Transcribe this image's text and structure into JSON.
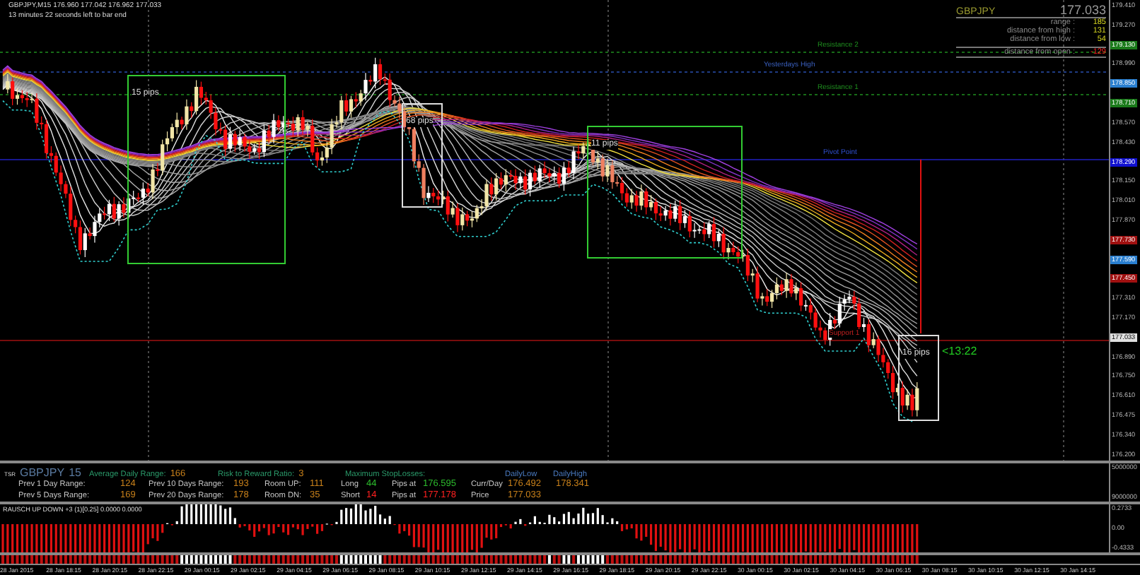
{
  "title_bar": {
    "symbol_line": "GBPJPY,M15  176.960 177.042 176.962 177.033",
    "countdown": "13 minutes 22 seconds left to bar end"
  },
  "level_lines": [
    {
      "label": "Resistance 2",
      "kind": "resistance"
    },
    {
      "label": "Yesterdays High",
      "kind": "yesterday"
    },
    {
      "label": "Resistance 1",
      "kind": "resistance"
    },
    {
      "label": "Pivot Point",
      "kind": "pivot"
    },
    {
      "label": "Support 1",
      "kind": "support"
    }
  ],
  "pip_boxes": [
    {
      "label": "15 pips",
      "color": "#33cc33"
    },
    {
      "label": "68 pips",
      "color": "#dddddd"
    },
    {
      "label": "11 pips",
      "color": "#33cc33"
    },
    {
      "label": "16 pips",
      "color": "#dddddd"
    }
  ],
  "timer": "<13:22",
  "quote_panel": {
    "symbol": "GBPJPY",
    "price": "177.033",
    "rows": [
      {
        "label": "range :",
        "value": "185",
        "kind": "up"
      },
      {
        "label": "distance from high :",
        "value": "131",
        "kind": "up"
      },
      {
        "label": "distance from low :",
        "value": "54",
        "kind": "up"
      },
      {
        "label": "distance from open :",
        "value": "-129",
        "kind": "down"
      }
    ]
  },
  "price_axis": [
    {
      "text": "179.410"
    },
    {
      "text": "179.270"
    },
    {
      "text": "179.130",
      "color": "#1a7a1a"
    },
    {
      "text": "178.990"
    },
    {
      "text": "178.850",
      "color": "#2a7fd0"
    },
    {
      "text": "178.710",
      "color": "#1a7a1a"
    },
    {
      "text": "178.570"
    },
    {
      "text": "178.430"
    },
    {
      "text": "178.290",
      "color": "#1010d0"
    },
    {
      "text": "178.150"
    },
    {
      "text": "178.010"
    },
    {
      "text": "177.870"
    },
    {
      "text": "177.730",
      "color": "#a01010"
    },
    {
      "text": "177.590",
      "color": "#2a7fd0"
    },
    {
      "text": "177.450",
      "color": "#a01010"
    },
    {
      "text": "177.310"
    },
    {
      "text": "177.170"
    },
    {
      "text": "177.033",
      "color": "#e0e0e0"
    },
    {
      "text": "176.890"
    },
    {
      "text": "176.750"
    },
    {
      "text": "176.610"
    },
    {
      "text": "176.475"
    },
    {
      "text": "176.340"
    },
    {
      "text": "176.200"
    }
  ],
  "info_panel": {
    "tag": "TSR",
    "symbol": "GBPJPY",
    "timeframe": "15",
    "headers": [
      {
        "text": "Average Daily Range:",
        "kind": "heading"
      },
      {
        "text": "166",
        "kind": "value"
      },
      {
        "text": "Risk to Reward Ratio:",
        "kind": "heading"
      },
      {
        "text": "3",
        "kind": "value"
      },
      {
        "text": "Maximum StopLosses:",
        "kind": "heading"
      },
      {
        "text": "DailyLow",
        "kind": "column"
      },
      {
        "text": "DailyHigh",
        "kind": "column"
      }
    ],
    "rows": [
      [
        {
          "text": "Prev 1 Day Range:",
          "kind": "label"
        },
        {
          "text": "124",
          "kind": "value"
        },
        {
          "text": "Prev 10 Days Range:",
          "kind": "label"
        },
        {
          "text": "193",
          "kind": "value"
        },
        {
          "text": "Room UP:",
          "kind": "label"
        },
        {
          "text": "111",
          "kind": "value"
        },
        {
          "text": "Long",
          "kind": "label"
        },
        {
          "text": "44",
          "kind": "up"
        },
        {
          "text": "Pips at",
          "kind": "label"
        },
        {
          "text": "176.595",
          "kind": "up"
        },
        {
          "text": "Curr/Day",
          "kind": "label"
        },
        {
          "text": "176.492",
          "kind": "value"
        },
        {
          "text": "178.341",
          "kind": "value"
        }
      ],
      [
        {
          "text": "Prev 5 Days Range:",
          "kind": "label"
        },
        {
          "text": "169",
          "kind": "value"
        },
        {
          "text": "Prev 20 Days Range:",
          "kind": "label"
        },
        {
          "text": "178",
          "kind": "value"
        },
        {
          "text": "Room DN:",
          "kind": "label"
        },
        {
          "text": "35",
          "kind": "value"
        },
        {
          "text": "Short",
          "kind": "label"
        },
        {
          "text": "14",
          "kind": "down"
        },
        {
          "text": "Pips at",
          "kind": "label"
        },
        {
          "text": "177.178",
          "kind": "down"
        },
        {
          "text": "Price",
          "kind": "label"
        },
        {
          "text": "177.033",
          "kind": "value"
        }
      ]
    ],
    "axis": [
      "5000000",
      "9000000"
    ]
  },
  "indicator": {
    "title": "RAUSCH UP DOWN +3 (1)[0.25] 0.0000 0.0000",
    "axis": [
      "0.2733",
      "0.00",
      "-0.4333"
    ]
  },
  "time_axis": [
    "28 Jan 2015",
    "28 Jan 18:15",
    "28 Jan 20:15",
    "28 Jan 22:15",
    "29 Jan 00:15",
    "29 Jan 02:15",
    "29 Jan 04:15",
    "29 Jan 06:15",
    "29 Jan 08:15",
    "29 Jan 10:15",
    "29 Jan 12:15",
    "29 Jan 14:15",
    "29 Jan 16:15",
    "29 Jan 18:15",
    "29 Jan 20:15",
    "29 Jan 22:15",
    "30 Jan 00:15",
    "30 Jan 02:15",
    "30 Jan 04:15",
    "30 Jan 06:15",
    "30 Jan 08:15",
    "30 Jan 10:15",
    "30 Jan 12:15",
    "30 Jan 14:15"
  ]
}
